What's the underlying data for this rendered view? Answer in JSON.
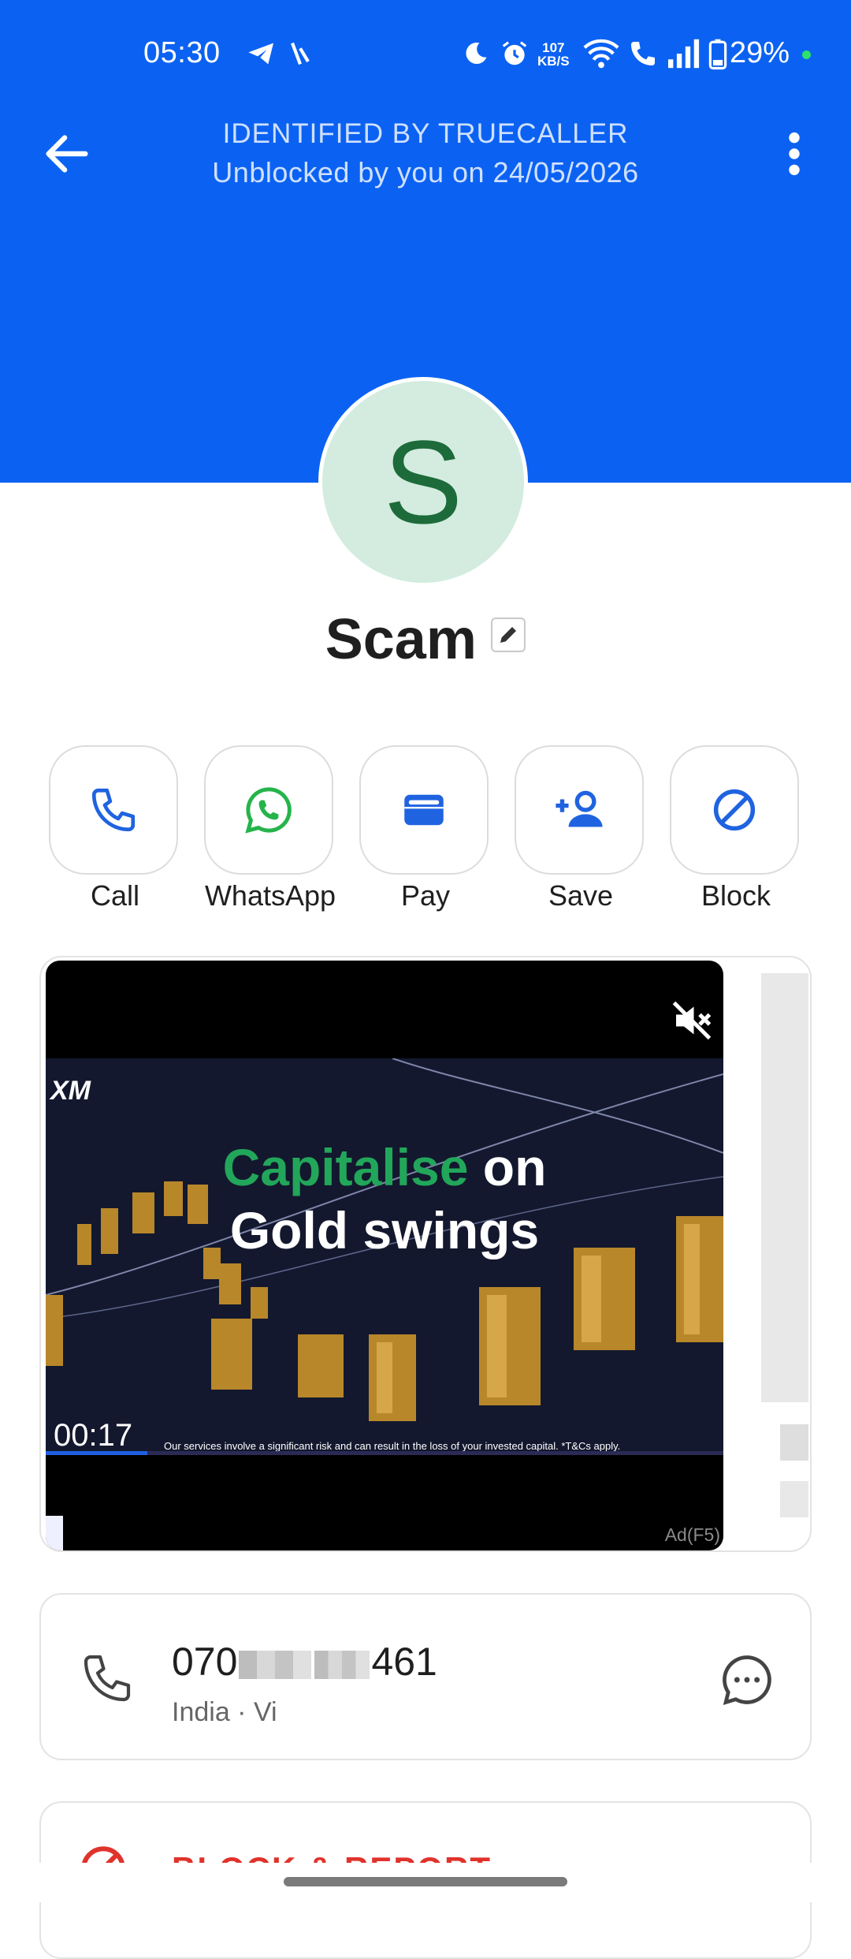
{
  "status_bar": {
    "time": "05:30",
    "network_speed_value": "107",
    "network_speed_unit": "KB/S",
    "battery": "29%"
  },
  "header": {
    "title": "IDENTIFIED BY TRUECALLER",
    "subtitle": "Unblocked by you on 24/05/2026",
    "background_color": "#0b62f2"
  },
  "contact": {
    "avatar_letter": "S",
    "name": "Scam"
  },
  "actions": [
    {
      "label": "Call",
      "icon": "phone-icon"
    },
    {
      "label": "WhatsApp",
      "icon": "whatsapp-icon"
    },
    {
      "label": "Pay",
      "icon": "wallet-icon"
    },
    {
      "label": "Save",
      "icon": "add-person-icon"
    },
    {
      "label": "Block",
      "icon": "block-icon"
    }
  ],
  "ad": {
    "brand": "XM",
    "headline_green": "Capitalise",
    "headline_white": "on",
    "headline_line2": "Gold swings",
    "disclaimer": "Our services involve a significant risk and can result in the loss of your invested capital. *T&Cs apply.",
    "timer": "00:17",
    "progress_fraction": 0.15,
    "tag": "Ad(F5)",
    "muted": true
  },
  "phone": {
    "number_start": "070",
    "number_end": "461",
    "meta": "India · Vi"
  },
  "report": {
    "label": "BLOCK & REPORT",
    "color": "#e0332b"
  }
}
